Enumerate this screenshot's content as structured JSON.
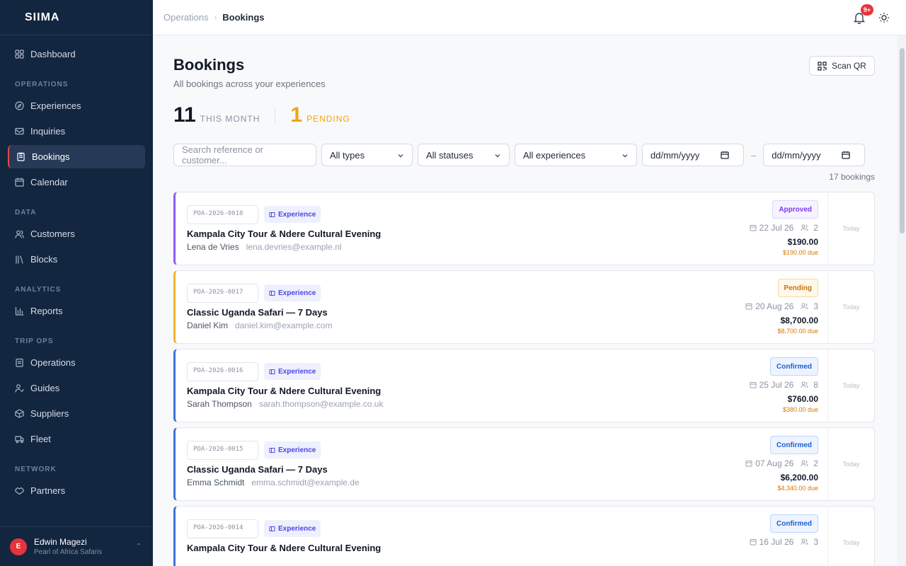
{
  "app": {
    "logo": "SIIMA"
  },
  "sidebar": {
    "top_item": {
      "label": "Dashboard"
    },
    "sections": [
      {
        "label": "OPERATIONS",
        "items": [
          {
            "label": "Experiences"
          },
          {
            "label": "Inquiries"
          },
          {
            "label": "Bookings",
            "active": true
          },
          {
            "label": "Calendar"
          }
        ]
      },
      {
        "label": "DATA",
        "items": [
          {
            "label": "Customers"
          },
          {
            "label": "Blocks"
          }
        ]
      },
      {
        "label": "ANALYTICS",
        "items": [
          {
            "label": "Reports"
          }
        ]
      },
      {
        "label": "TRIP OPS",
        "items": [
          {
            "label": "Operations"
          },
          {
            "label": "Guides"
          },
          {
            "label": "Suppliers"
          },
          {
            "label": "Fleet"
          }
        ]
      },
      {
        "label": "NETWORK",
        "items": [
          {
            "label": "Partners"
          }
        ]
      }
    ],
    "user": {
      "initial": "E",
      "name": "Edwin Magezi",
      "org": "Pearl of Africa Safaris"
    }
  },
  "topbar": {
    "breadcrumb_parent": "Operations",
    "breadcrumb_current": "Bookings",
    "notification_count": "9+"
  },
  "page": {
    "title": "Bookings",
    "subtitle": "All bookings across your experiences",
    "scan_label": "Scan QR",
    "stats": {
      "month_count": "11",
      "month_label": "THIS MONTH",
      "pending_count": "1",
      "pending_label": "PENDING"
    },
    "filters": {
      "search_placeholder": "Search reference or customer...",
      "type": "All types",
      "status": "All statuses",
      "experience": "All experiences",
      "date_from": "dd/mm/yyyy",
      "date_sep": "–",
      "date_to": "dd/mm/yyyy"
    },
    "count_label": "17 bookings"
  },
  "colors": {
    "accent": "#e5343c",
    "sidebar_bg": "#132640",
    "pending": "#f1a316",
    "experience_tag": "#4f46e5"
  },
  "bookings": [
    {
      "ref": "POA-2026-0018",
      "type": "Experience",
      "title": "Kampala City Tour & Ndere Cultural Evening",
      "customer": "Lena de Vries",
      "email": "lena.devries@example.nl",
      "status": "Approved",
      "status_class": "approved",
      "accent": "#8b5cf6",
      "date": "22 Jul 26",
      "pax": "2",
      "price": "$190.00",
      "due": "$190.00 due",
      "when": "Today"
    },
    {
      "ref": "POA-2026-0017",
      "type": "Experience",
      "title": "Classic Uganda Safari — 7 Days",
      "customer": "Daniel Kim",
      "email": "daniel.kim@example.com",
      "status": "Pending",
      "status_class": "pending",
      "accent": "#f1b52b",
      "date": "20 Aug 26",
      "pax": "3",
      "price": "$8,700.00",
      "due": "$8,700.00 due",
      "when": "Today"
    },
    {
      "ref": "POA-2026-0016",
      "type": "Experience",
      "title": "Kampala City Tour & Ndere Cultural Evening",
      "customer": "Sarah Thompson",
      "email": "sarah.thompson@example.co.uk",
      "status": "Confirmed",
      "status_class": "confirmed",
      "accent": "#3b73d9",
      "date": "25 Jul 26",
      "pax": "8",
      "price": "$760.00",
      "due": "$380.00 due",
      "when": "Today"
    },
    {
      "ref": "POA-2026-0015",
      "type": "Experience",
      "title": "Classic Uganda Safari — 7 Days",
      "customer": "Emma Schmidt",
      "email": "emma.schmidt@example.de",
      "status": "Confirmed",
      "status_class": "confirmed",
      "accent": "#3b73d9",
      "date": "07 Aug 26",
      "pax": "2",
      "price": "$6,200.00",
      "due": "$4,340.00 due",
      "when": "Today"
    },
    {
      "ref": "POA-2026-0014",
      "type": "Experience",
      "title": "Kampala City Tour & Ndere Cultural Evening",
      "customer": "",
      "email": "",
      "status": "Confirmed",
      "status_class": "confirmed",
      "accent": "#3b73d9",
      "date": "16 Jul 26",
      "pax": "3",
      "price": "",
      "due": "",
      "when": "Today"
    }
  ]
}
